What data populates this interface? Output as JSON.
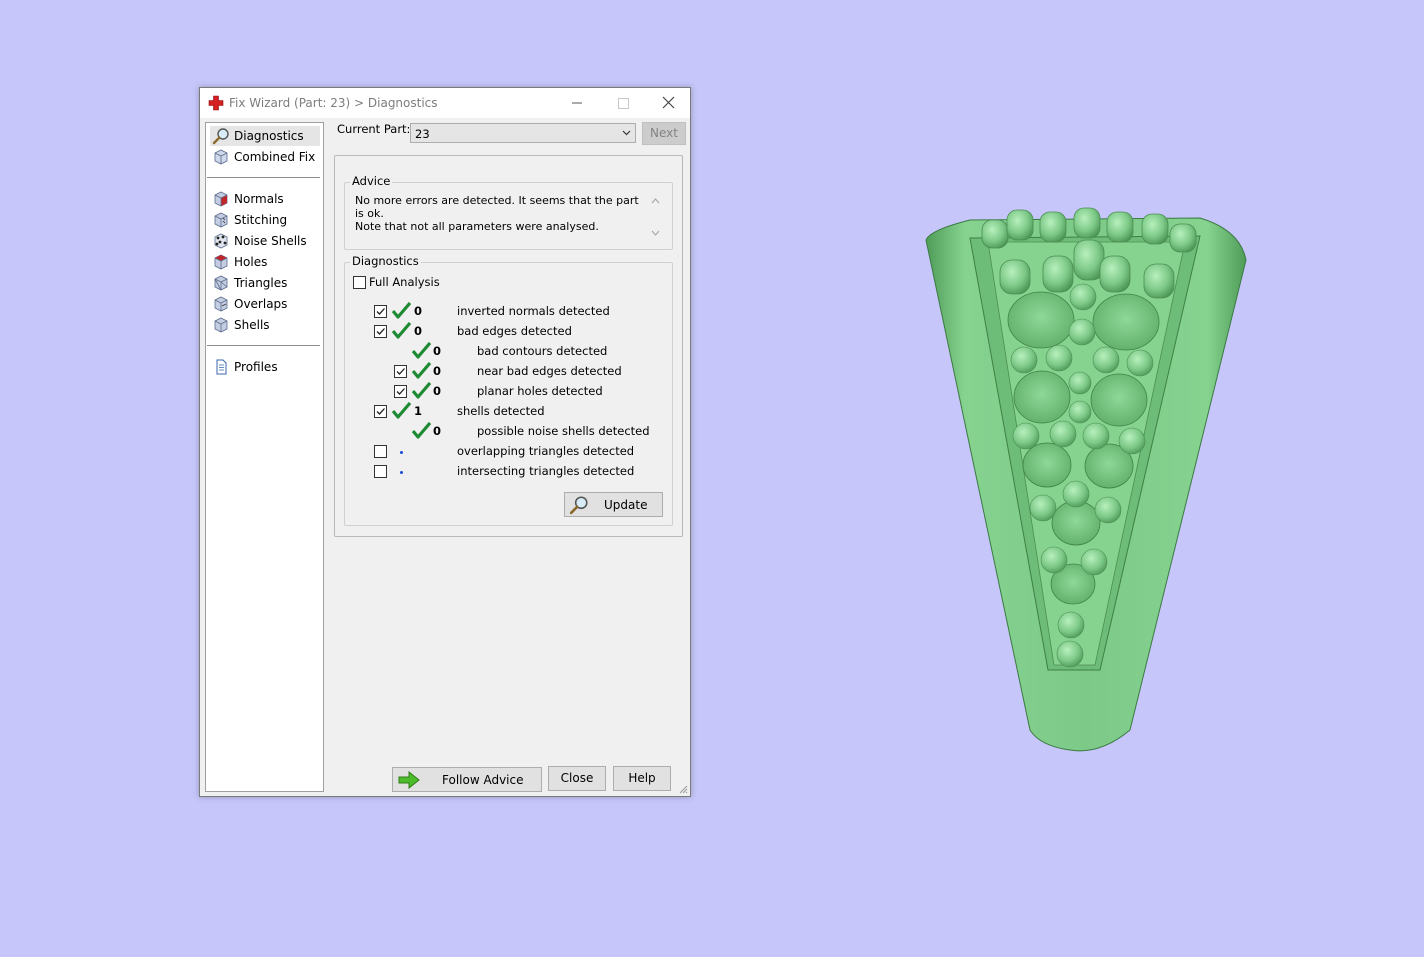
{
  "window": {
    "title": "Fix Wizard (Part: 23) > Diagnostics"
  },
  "sidebar": {
    "items": [
      {
        "label": "Diagnostics",
        "icon": "magnifier-icon"
      },
      {
        "label": "Combined Fix",
        "icon": "cube-icon"
      },
      {
        "label": "Normals",
        "icon": "normals-cube-icon"
      },
      {
        "label": "Stitching",
        "icon": "stitching-cube-icon"
      },
      {
        "label": "Noise Shells",
        "icon": "noise-shells-icon"
      },
      {
        "label": "Holes",
        "icon": "holes-cube-icon"
      },
      {
        "label": "Triangles",
        "icon": "triangles-cube-icon"
      },
      {
        "label": "Overlaps",
        "icon": "overlaps-cube-icon"
      },
      {
        "label": "Shells",
        "icon": "shells-cube-icon"
      },
      {
        "label": "Profiles",
        "icon": "document-icon"
      }
    ]
  },
  "current_part": {
    "label": "Current Part:",
    "value": "23",
    "next_label": "Next"
  },
  "advice": {
    "legend": "Advice",
    "line1": "No more errors are detected. It seems that the part is ok.",
    "line2": "Note that not all parameters were analysed."
  },
  "diagnostics": {
    "legend": "Diagnostics",
    "full_analysis_label": "Full Analysis",
    "full_analysis_checked": false,
    "rows": [
      {
        "checkbox": true,
        "checked": true,
        "status": "ok",
        "count": "0",
        "label": "inverted normals detected",
        "indent": 0
      },
      {
        "checkbox": true,
        "checked": true,
        "status": "ok",
        "count": "0",
        "label": "bad edges detected",
        "indent": 0
      },
      {
        "checkbox": false,
        "checked": false,
        "status": "ok",
        "count": "0",
        "label": "bad contours detected",
        "indent": 1
      },
      {
        "checkbox": true,
        "checked": true,
        "status": "ok",
        "count": "0",
        "label": "near bad edges detected",
        "indent": 1
      },
      {
        "checkbox": true,
        "checked": true,
        "status": "ok",
        "count": "0",
        "label": "planar holes detected",
        "indent": 1
      },
      {
        "checkbox": true,
        "checked": true,
        "status": "ok",
        "count": "1",
        "label": "shells detected",
        "indent": 0
      },
      {
        "checkbox": false,
        "checked": false,
        "status": "ok",
        "count": "0",
        "label": "possible noise shells detected",
        "indent": 1
      },
      {
        "checkbox": true,
        "checked": false,
        "status": "not-run",
        "count": "",
        "label": "overlapping triangles detected",
        "indent": 0
      },
      {
        "checkbox": true,
        "checked": false,
        "status": "not-run",
        "count": "",
        "label": "intersecting triangles detected",
        "indent": 0
      }
    ],
    "update_label": "Update"
  },
  "footer": {
    "follow_advice_label": "Follow Advice",
    "close_label": "Close",
    "help_label": "Help"
  },
  "colors": {
    "desktop": "#c6c6fa",
    "model": "#7fcf8a",
    "check": "#1e8a32"
  }
}
